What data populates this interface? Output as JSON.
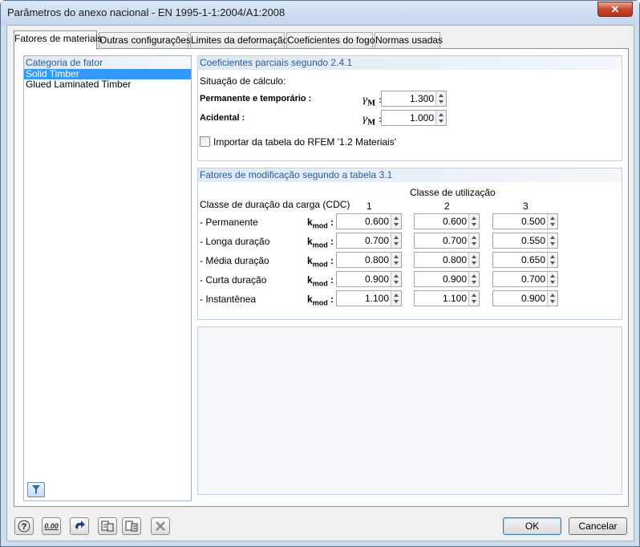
{
  "window": {
    "title": "Parâmetros do anexo nacional - EN 1995-1-1:2004/A1:2008",
    "close_glyph": "✕"
  },
  "tabs": [
    {
      "label": "Fatores de materiais",
      "active": true
    },
    {
      "label": "Outras configurações",
      "active": false
    },
    {
      "label": "Limites da deformação",
      "active": false
    },
    {
      "label": "Coeficientes do fogo",
      "active": false
    },
    {
      "label": "Normas usadas",
      "active": false
    }
  ],
  "category": {
    "header": "Categoria de fator",
    "items": [
      "Solid Timber",
      "Glued Laminated Timber"
    ],
    "selected": "Solid Timber",
    "filter_icon": "filter-icon"
  },
  "partial": {
    "header": "Coeficientes parciais segundo 2.4.1",
    "situation_label": "Situação de cálculo:",
    "permanent_label": "Permanente e temporário :",
    "accidental_label": "Acidental :",
    "gamma_symbol": "γ",
    "gamma_sub": "M",
    "gamma_suffix": " :",
    "permanent_value": "1.300",
    "accidental_value": "1.000",
    "import_label": "Importar da tabela do RFEM '1.2 Materiais'",
    "import_checked": false
  },
  "kmod": {
    "header": "Fatores de modificação segundo a tabela 3.1",
    "service_class_label": "Classe de utilização",
    "load_duration_label": "Classe de duração da carga (CDC)",
    "columns": [
      "1",
      "2",
      "3"
    ],
    "symbol": "k",
    "symbol_sub": "mod",
    "symbol_suffix": " :",
    "rows": [
      {
        "label": "- Permanente",
        "values": [
          "0.600",
          "0.600",
          "0.500"
        ]
      },
      {
        "label": "- Longa duração",
        "values": [
          "0.700",
          "0.700",
          "0.550"
        ]
      },
      {
        "label": "- Média duração",
        "values": [
          "0.800",
          "0.800",
          "0.650"
        ]
      },
      {
        "label": "- Curta duração",
        "values": [
          "0.900",
          "0.900",
          "0.700"
        ]
      },
      {
        "label": "- Instantênea",
        "values": [
          "1.100",
          "1.100",
          "0.900"
        ]
      }
    ]
  },
  "toolbar": {
    "icons": [
      "help-icon",
      "decimal-places-icon",
      "reset-icon",
      "export-icon",
      "import-icon",
      "delete-icon"
    ],
    "decimal_text": "0.00",
    "ok_label": "OK",
    "cancel_label": "Cancelar"
  }
}
